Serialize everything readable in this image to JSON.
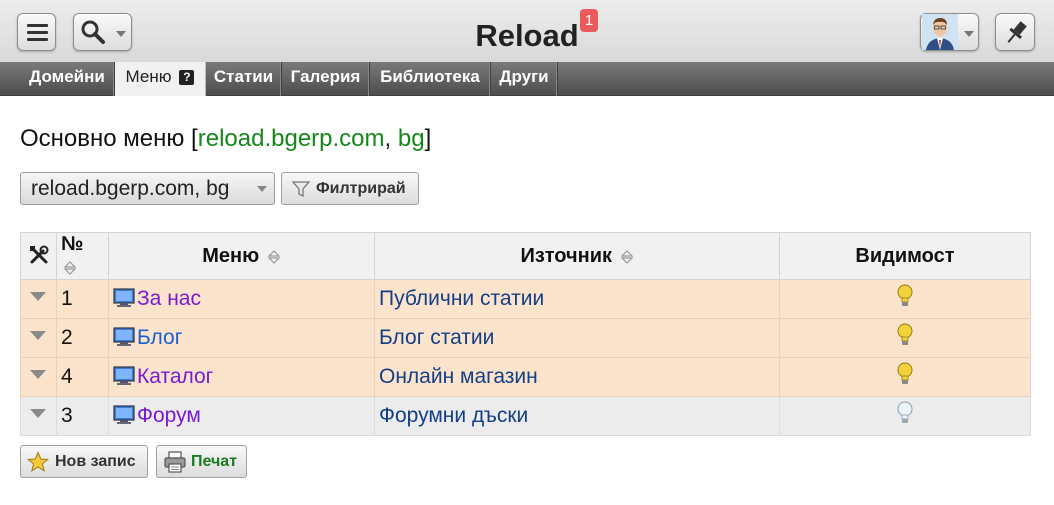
{
  "header": {
    "title": "Reload",
    "notification_count": "1"
  },
  "tabs": [
    {
      "label": "Домейни"
    },
    {
      "label": "Меню"
    },
    {
      "label": "Статии"
    },
    {
      "label": "Галерия"
    },
    {
      "label": "Библиотека"
    },
    {
      "label": "Други"
    }
  ],
  "help_icon_label": "?",
  "page": {
    "title_prefix": "Основно меню [",
    "title_domain": "reload.bgerp.com",
    "title_sep": ", ",
    "title_lang": "bg",
    "title_suffix": "]"
  },
  "filter": {
    "selected_domain": "reload.bgerp.com, bg",
    "button_label": "Филтрирай"
  },
  "table": {
    "columns": {
      "number": "№",
      "menu": "Меню",
      "source": "Източник",
      "visibility": "Видимост"
    },
    "rows": [
      {
        "number": "1",
        "menu": "За нас",
        "source": "Публични статии",
        "visible": true
      },
      {
        "number": "2",
        "menu": "Блог",
        "source": "Блог статии",
        "visible": true
      },
      {
        "number": "4",
        "menu": "Каталог",
        "source": "Онлайн магазин",
        "visible": true
      },
      {
        "number": "3",
        "menu": "Форум",
        "source": "Форумни дъски",
        "visible": false
      }
    ]
  },
  "actions": {
    "new_record": "Нов запис",
    "print": "Печат"
  },
  "colors": {
    "active_row": "#fce4cc",
    "inactive_row": "#ececec",
    "link_green": "#16881b",
    "notification": "#ec5b5b"
  },
  "icons": {
    "menu": "hamburger-icon",
    "search": "magnifier-icon",
    "pin": "pin-icon",
    "tools": "tools-icon",
    "filter": "funnel-icon",
    "page": "monitor-icon",
    "visible": "lightbulb-on-icon",
    "hidden": "lightbulb-off-icon",
    "new": "star-icon",
    "print": "printer-icon"
  }
}
